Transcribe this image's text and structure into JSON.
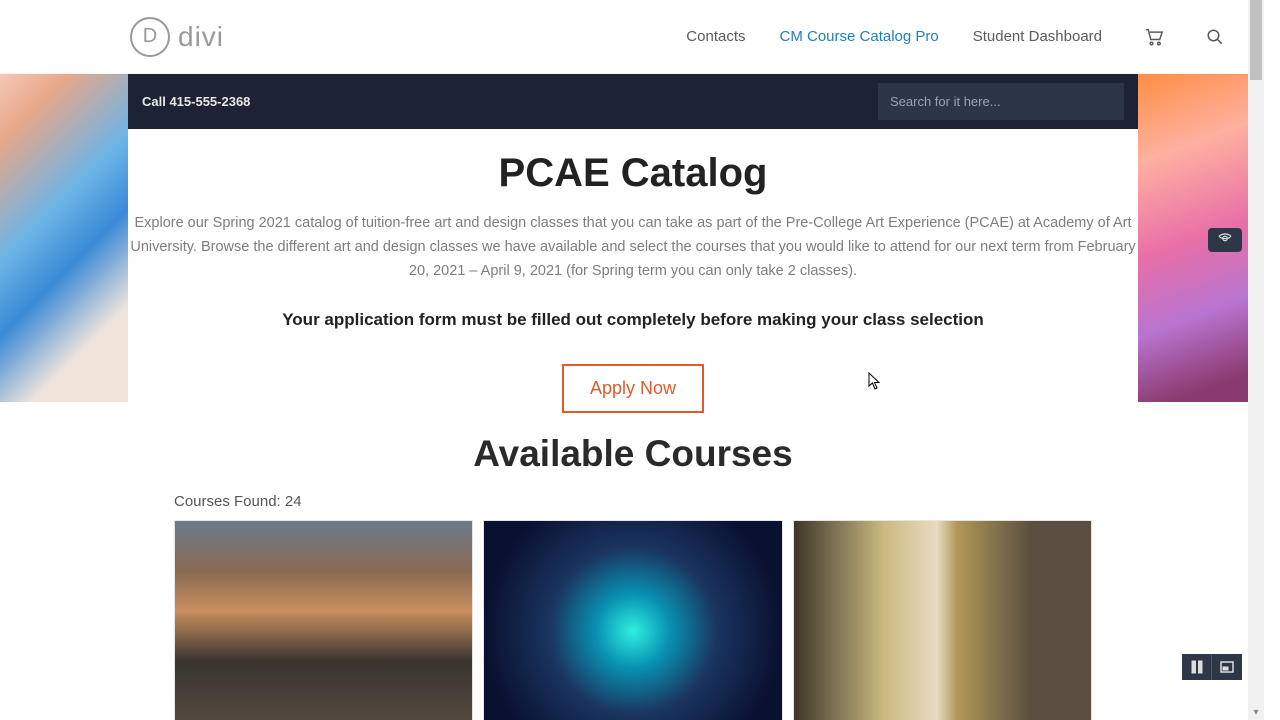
{
  "logo": {
    "letter": "D",
    "text": "divi"
  },
  "nav": {
    "contacts": "Contacts",
    "catalogPro": "CM Course Catalog Pro",
    "dashboard": "Student Dashboard"
  },
  "blackbar": {
    "call": "Call 415-555-2368",
    "searchPlaceholder": "Search for it here..."
  },
  "hero": {
    "title": "PCAE Catalog",
    "desc": "Explore our Spring 2021 catalog of tuition-free art and design classes that you can take as part of the Pre-College Art Experience (PCAE) at Academy of Art University. Browse the different art and design classes we have available and select the courses that you would like to attend for our next term from February 20, 2021 – April 9, 2021 (for Spring term you can only take 2 classes).",
    "notice": "Your application form must be filled out completely before making your class selection",
    "apply": "Apply Now"
  },
  "courses": {
    "heading": "Available Courses",
    "foundLabel": "Courses Found:",
    "foundCount": "24"
  }
}
